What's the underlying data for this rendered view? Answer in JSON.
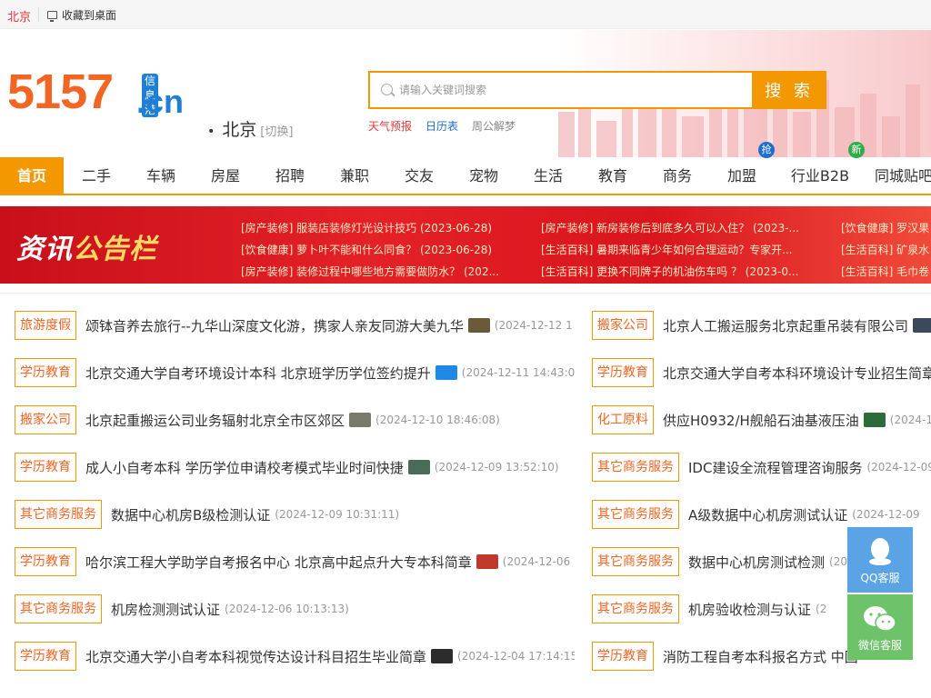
{
  "topbar": {
    "city": "北京",
    "favorite": "收藏到桌面"
  },
  "logo": {
    "number": "5157",
    "domain": ".cn",
    "tag": "信息港"
  },
  "location": {
    "city": "北京",
    "switch": "[切换]"
  },
  "search": {
    "placeholder": "请输入关键词搜索",
    "value": "",
    "button": "搜 索"
  },
  "hot_links": [
    "天气预报",
    "日历表",
    "周公解梦"
  ],
  "nav": {
    "items": [
      "首页",
      "二手",
      "车辆",
      "房屋",
      "招聘",
      "兼职",
      "交友",
      "宠物",
      "生活",
      "教育",
      "商务",
      "加盟",
      "行业B2B",
      "同城贴吧"
    ],
    "active": "首页",
    "badges": [
      {
        "text": "抢",
        "color": "#1f6fd0"
      },
      {
        "text": "新",
        "color": "#2fae48"
      }
    ]
  },
  "banner": {
    "title_part1": "资讯",
    "title_part2": "公告栏",
    "news": [
      [
        "[房产装修] 服装店装修灯光设计技巧 (2023-06-28)",
        "[房产装修] 新房装修后到底多久可以入住？ (2023-...",
        "[饮食健康] 罗汉果"
      ],
      [
        "[饮食健康] 萝卜叶不能和什么同食？ (2023-06-28)",
        "[生活百科] 暑期来临青少年如何合理运动？专家开...",
        "[生活百科] 矿泉水"
      ],
      [
        "[房产装修] 装修过程中哪些地方需要做防水？ (202...",
        "[生活百科] 更换不同牌子的机油伤车吗 ？ (2023-0...",
        "[生活百科] 毛巾卷"
      ]
    ]
  },
  "listings_left": [
    {
      "cat": "旅游度假",
      "title": "颂钵音养去旅行--九华山深度文化游，携家人亲友同游大美九华",
      "thumb": "#6b5a3a",
      "date": "(2024-12-12 1"
    },
    {
      "cat": "学历教育",
      "title": "北京交通大学自考环境设计本科 北京班学历学位签约提升",
      "thumb": "#1e88e5",
      "date": "(2024-12-11 14:43:0"
    },
    {
      "cat": "搬家公司",
      "title": "北京起重搬运公司业务辐射北京全市区郊区",
      "thumb": "#7a7a6a",
      "date": "(2024-12-10 18:46:08)"
    },
    {
      "cat": "学历教育",
      "title": "成人小自考本科 学历学位申请校考模式毕业时间快捷",
      "thumb": "#4a6a5a",
      "date": "(2024-12-09 13:52:10)"
    },
    {
      "cat": "其它商务服务",
      "title": "数据中心机房B级检测认证",
      "thumb": "",
      "date": "(2024-12-09 10:31:11)"
    },
    {
      "cat": "学历教育",
      "title": "哈尔滨工程大学助学自考报名中心 北京高中起点升大专本科简章",
      "thumb": "#c0392b",
      "date": "(2024-12-06"
    },
    {
      "cat": "其它商务服务",
      "title": "机房检测测试认证",
      "thumb": "",
      "date": "(2024-12-06 10:13:13)"
    },
    {
      "cat": "学历教育",
      "title": "北京交通大学小自考本科视觉传达设计科目招生毕业简章",
      "thumb": "#2c2c2c",
      "date": "(2024-12-04 17:14:15)"
    }
  ],
  "listings_right": [
    {
      "cat": "搬家公司",
      "title": "北京人工搬运服务北京起重吊装有限公司",
      "thumb": "#3a4a5a",
      "date": ""
    },
    {
      "cat": "学历教育",
      "title": "北京交通大学自考本科环境设计专业招生简章",
      "thumb": "",
      "date": ""
    },
    {
      "cat": "化工原料",
      "title": "供应H0932/H舰船石油基液压油",
      "thumb": "#2e6b3a",
      "date": "(2024-12"
    },
    {
      "cat": "其它商务服务",
      "title": "IDC建设全流程管理咨询服务",
      "thumb": "",
      "date": "(2024-12-09"
    },
    {
      "cat": "其它商务服务",
      "title": "A级数据中心机房测试认证",
      "thumb": "",
      "date": "(2024-12-09"
    },
    {
      "cat": "其它商务服务",
      "title": "数据中心机房测试检测",
      "thumb": "",
      "date": "(20"
    },
    {
      "cat": "其它商务服务",
      "title": "机房验收检测与认证",
      "thumb": "",
      "date": "(2"
    },
    {
      "cat": "学历教育",
      "title": "消防工程自考本科报名方式 中国",
      "thumb": "",
      "date": ""
    }
  ],
  "service": {
    "qq": "QQ客服",
    "wechat": "微信客服"
  }
}
